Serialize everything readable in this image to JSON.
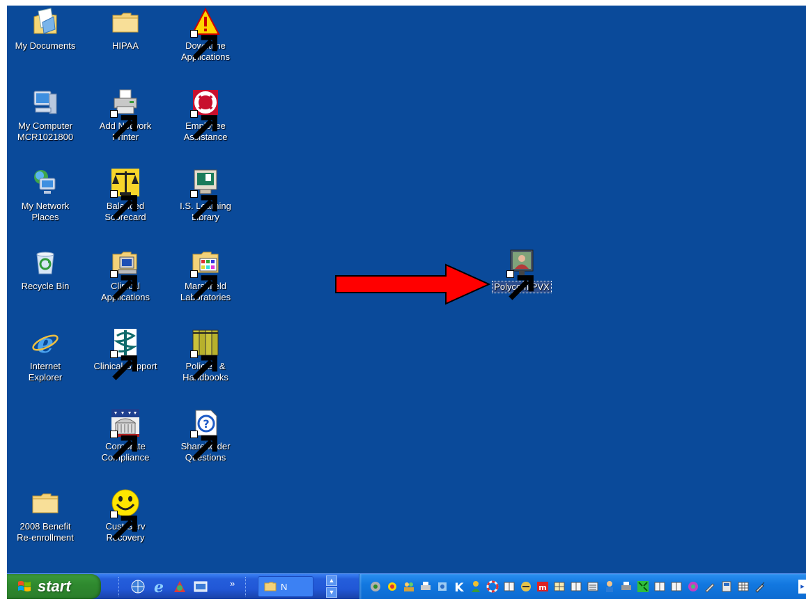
{
  "desktop": {
    "icons": [
      {
        "key": "my_documents",
        "label": "My Documents",
        "icon": "my-documents-icon"
      },
      {
        "key": "hipaa",
        "label": "HIPAA",
        "icon": "folder-icon"
      },
      {
        "key": "downtime",
        "label": "Downtime\nApplications",
        "icon": "warning-icon"
      },
      {
        "key": "my_computer",
        "label": "My Computer\nMCR1021800",
        "icon": "computer-icon"
      },
      {
        "key": "add_printer",
        "label": "Add Network\nPrinter",
        "icon": "printer-icon"
      },
      {
        "key": "employee_assist",
        "label": "Employee\nAssistance",
        "icon": "lifesaver-icon"
      },
      {
        "key": "my_network",
        "label": "My Network\nPlaces",
        "icon": "network-places-icon"
      },
      {
        "key": "balanced",
        "label": "Balanced\nScorecard",
        "icon": "scales-icon"
      },
      {
        "key": "is_learning",
        "label": "I.S. Learning\nLibrary",
        "icon": "monitor-icon"
      },
      {
        "key": "recycle",
        "label": "Recycle Bin",
        "icon": "recycle-bin-icon"
      },
      {
        "key": "clinical_apps",
        "label": "Clinical\nApplications",
        "icon": "folder-computer-icon"
      },
      {
        "key": "marshfield",
        "label": "Marshfield\nLaboratories",
        "icon": "folder-apps-icon"
      },
      {
        "key": "ie",
        "label": "Internet\nExplorer",
        "icon": "internet-explorer-icon"
      },
      {
        "key": "clinical_support",
        "label": "Clinical Support",
        "icon": "caduceus-icon"
      },
      {
        "key": "policies",
        "label": "Policies &\nHandbooks",
        "icon": "binders-icon"
      },
      {
        "key": "corp_compliance",
        "label": "Corporate\nCompliance",
        "icon": "capitol-icon"
      },
      {
        "key": "shareholder",
        "label": "Shareholder\nQuestions",
        "icon": "help-icon"
      },
      {
        "key": "benefit",
        "label": "2008 Benefit\nRe-enrollment",
        "icon": "folder-icon"
      },
      {
        "key": "cust_serv",
        "label": "Cust Serv\nRecovery",
        "icon": "smiley-icon"
      },
      {
        "key": "polycom",
        "label": "Polycom PVX",
        "icon": "polycom-icon"
      }
    ]
  },
  "taskbar": {
    "start_label": "start",
    "task_button_label": "N",
    "quick_launch_overflow": "»",
    "tray_overflow": "▸"
  },
  "colors": {
    "desktop": "#0a4a9a",
    "arrow": "#ff0000",
    "taskbar": "#245edb",
    "start": "#2f8a2f"
  }
}
